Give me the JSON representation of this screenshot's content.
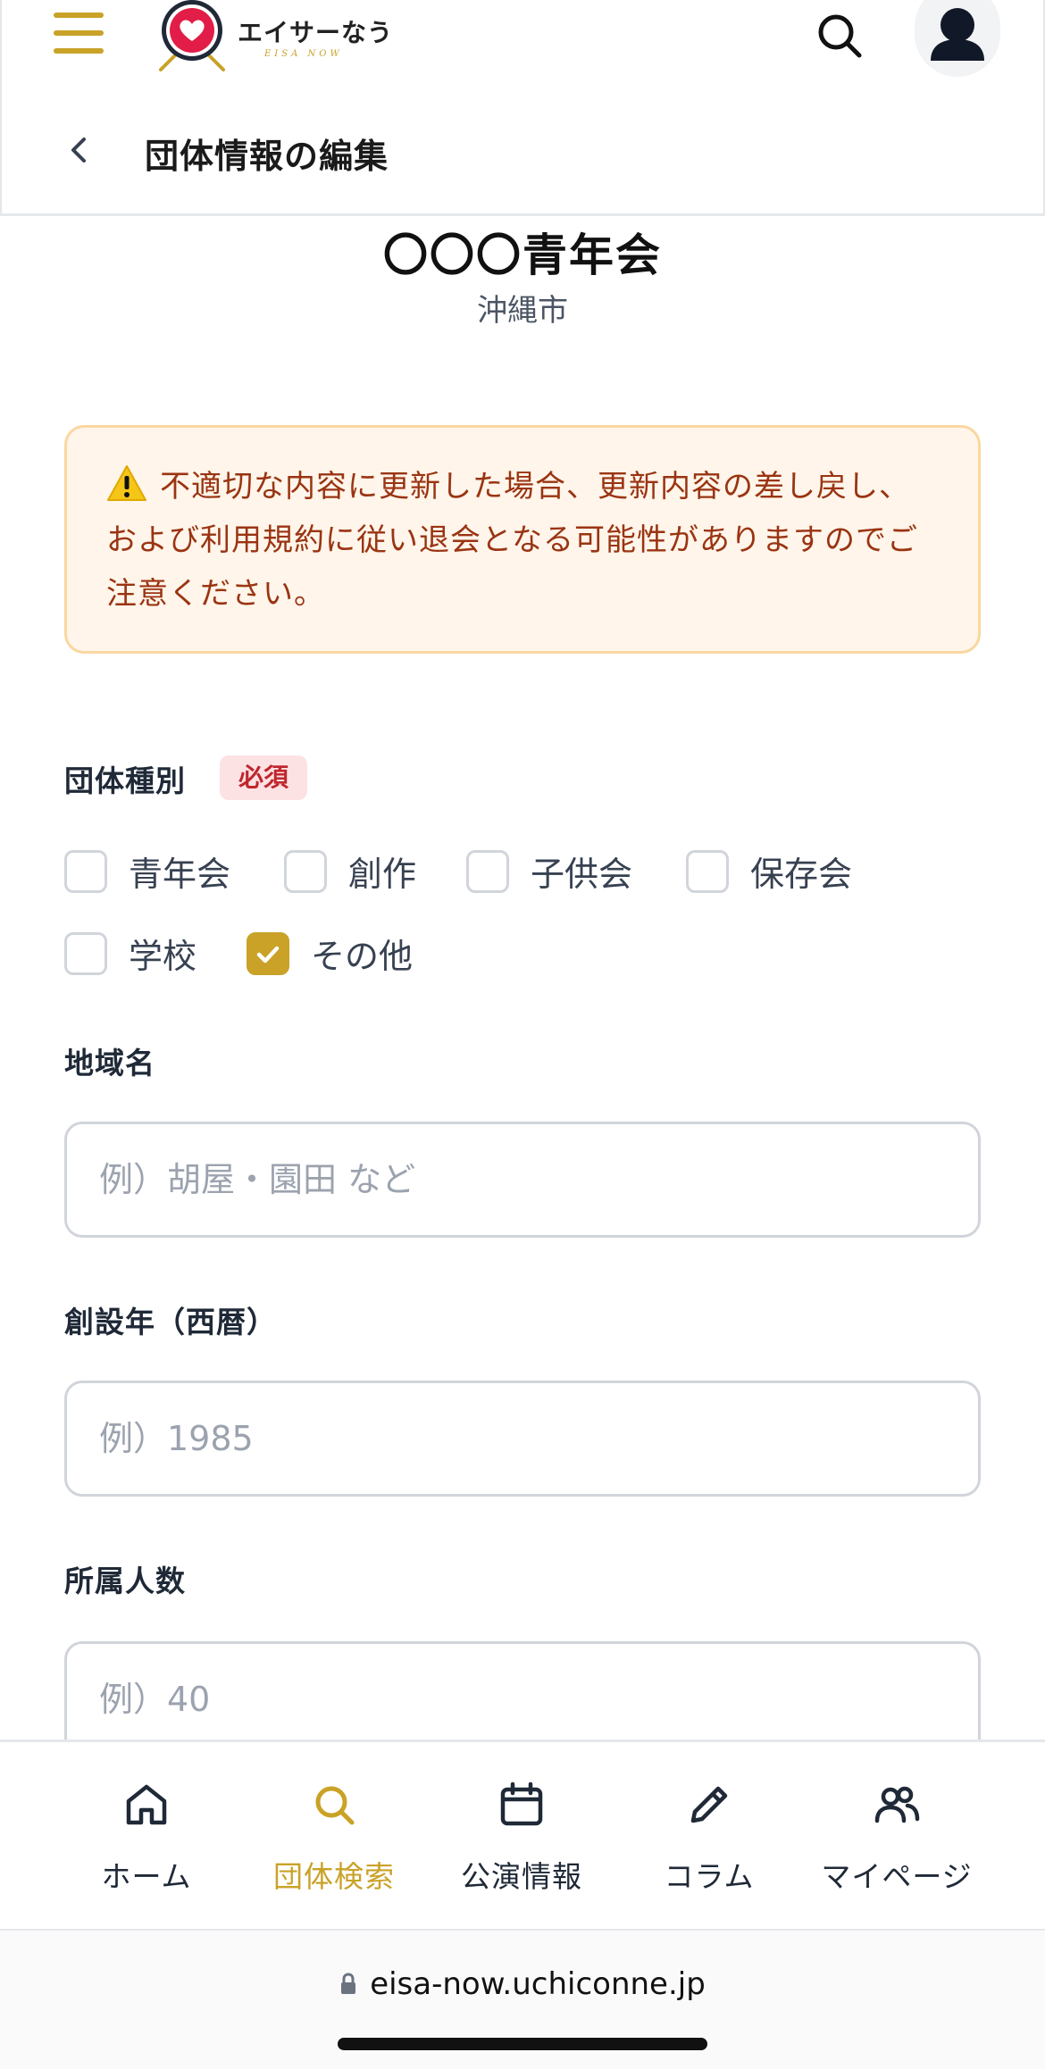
{
  "header": {
    "logo_text": "エイサーなう",
    "logo_subtext": "EISA NOW",
    "page_title": "団体情報の編集"
  },
  "group": {
    "name": "〇〇〇青年会",
    "city": "沖縄市"
  },
  "warning": {
    "text": "不適切な内容に更新した場合、更新内容の差し戻し、および利用規約に従い退会となる可能性がありますのでご注意ください。"
  },
  "form": {
    "group_type": {
      "label": "団体種別",
      "required_badge": "必須",
      "options": [
        {
          "label": "青年会",
          "checked": false
        },
        {
          "label": "創作",
          "checked": false
        },
        {
          "label": "子供会",
          "checked": false
        },
        {
          "label": "保存会",
          "checked": false
        },
        {
          "label": "学校",
          "checked": false
        },
        {
          "label": "その他",
          "checked": true
        }
      ]
    },
    "region": {
      "label": "地域名",
      "placeholder": "例）胡屋・園田 など",
      "value": ""
    },
    "founded": {
      "label": "創設年（西暦）",
      "placeholder": "例）1985",
      "value": ""
    },
    "members": {
      "label": "所属人数",
      "placeholder": "例）40",
      "value": ""
    }
  },
  "nav": {
    "items": [
      {
        "label": "ホーム",
        "icon": "home-icon",
        "active": false
      },
      {
        "label": "団体検索",
        "icon": "search-icon",
        "active": true
      },
      {
        "label": "公演情報",
        "icon": "calendar-icon",
        "active": false
      },
      {
        "label": "コラム",
        "icon": "pencil-icon",
        "active": false
      },
      {
        "label": "マイページ",
        "icon": "users-icon",
        "active": false
      }
    ]
  },
  "browser": {
    "url": "eisa-now.uchiconne.jp"
  },
  "colors": {
    "accent": "#c9a227",
    "warning_bg": "#fff5ea",
    "warning_border": "#fad7a0",
    "warning_text": "#9a3412",
    "required_bg": "#fde2e4",
    "required_text": "#c0262d"
  }
}
